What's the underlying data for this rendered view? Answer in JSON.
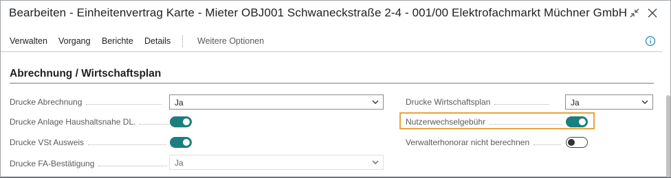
{
  "window": {
    "title": "Bearbeiten - Einheitenvertrag Karte - Mieter OBJ001 Schwaneckstraße 2-4 - 001/00 Elektrofachmarkt Müchner GmbH",
    "collapse_icon": "collapse-arrows-icon",
    "close_icon": "close-icon"
  },
  "actions": {
    "items": [
      {
        "label": "Verwalten"
      },
      {
        "label": "Vorgang"
      },
      {
        "label": "Berichte"
      },
      {
        "label": "Details"
      }
    ],
    "more_label": "Weitere Optionen",
    "info_icon": "info-icon"
  },
  "section": {
    "title": "Abrechnung / Wirtschaftsplan"
  },
  "fields_left": {
    "drucke_abrechnung": {
      "label": "Drucke Abrechnung",
      "value": "Ja"
    },
    "drucke_anlage": {
      "label": "Drucke Anlage Haushaltsnahe DL.",
      "checked": true
    },
    "drucke_vst": {
      "label": "Drucke VSt Ausweis",
      "checked": true
    },
    "drucke_fa": {
      "label": "Drucke FA-Bestätigung",
      "value": "Ja"
    }
  },
  "fields_right": {
    "drucke_wirtschaftsplan": {
      "label": "Drucke Wirtschaftsplan",
      "value": "Ja"
    },
    "nutzerwechselgebuehr": {
      "label": "Nutzerwechselgebühr",
      "checked": true
    },
    "verwalterhonorar": {
      "label": "Verwalterhonorar nicht berechnen",
      "checked": false
    }
  },
  "colors": {
    "toggle_on": "#1b7f7f",
    "highlight": "#e8a33d",
    "info": "#1a86c9"
  }
}
